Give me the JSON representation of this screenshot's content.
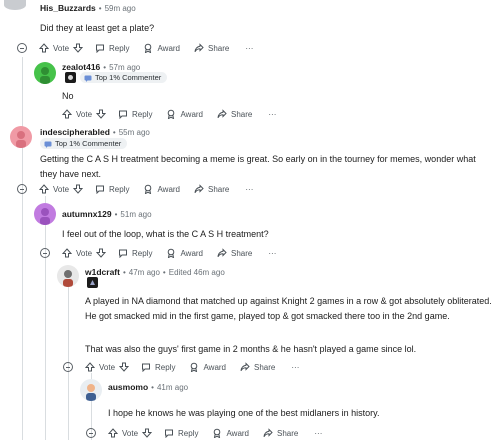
{
  "actions": {
    "vote": "Vote",
    "reply": "Reply",
    "award": "Award",
    "share": "Share",
    "more": "···"
  },
  "comments": [
    {
      "username": "His_Buzzards",
      "time": "59m ago",
      "body": "Did they at least get a plate?",
      "flair": "",
      "avatar_color": "#b8bcc0"
    },
    {
      "username": "zealot416",
      "time": "57m ago",
      "body": "No",
      "flair": "Top 1% Commenter",
      "avatar_color": "#46c24a"
    },
    {
      "username": "indescipherabled",
      "time": "55m ago",
      "body": "Getting the C A S H treatment becoming a meme is great. So early on in the tourney for memes, wonder what they have next.",
      "flair": "Top 1% Commenter",
      "avatar_color": "#f09aa5"
    },
    {
      "username": "autumnx129",
      "time": "51m ago",
      "body": "I feel out of the loop, what is the C A S H treatment?",
      "flair": "",
      "avatar_color": "#c17be0"
    },
    {
      "username": "w1dcraft",
      "time": "47m ago",
      "edited": "Edited 46m ago",
      "body": "A played in NA diamond that matched up against Knight 2 games in a row & got absolutely obliterated. He got smacked mid in the first game, played top & got smacked there too in the 2nd game.",
      "body2": "That was also the guys' first game in 2 months & he hasn't played a game since lol.",
      "flair": "",
      "avatar_color": "#e8e8e8"
    },
    {
      "username": "ausmomo",
      "time": "41m ago",
      "body": "I hope he knows he was playing one of the best midlaners in history.",
      "flair": "",
      "avatar_color": "#e9eef2"
    }
  ]
}
